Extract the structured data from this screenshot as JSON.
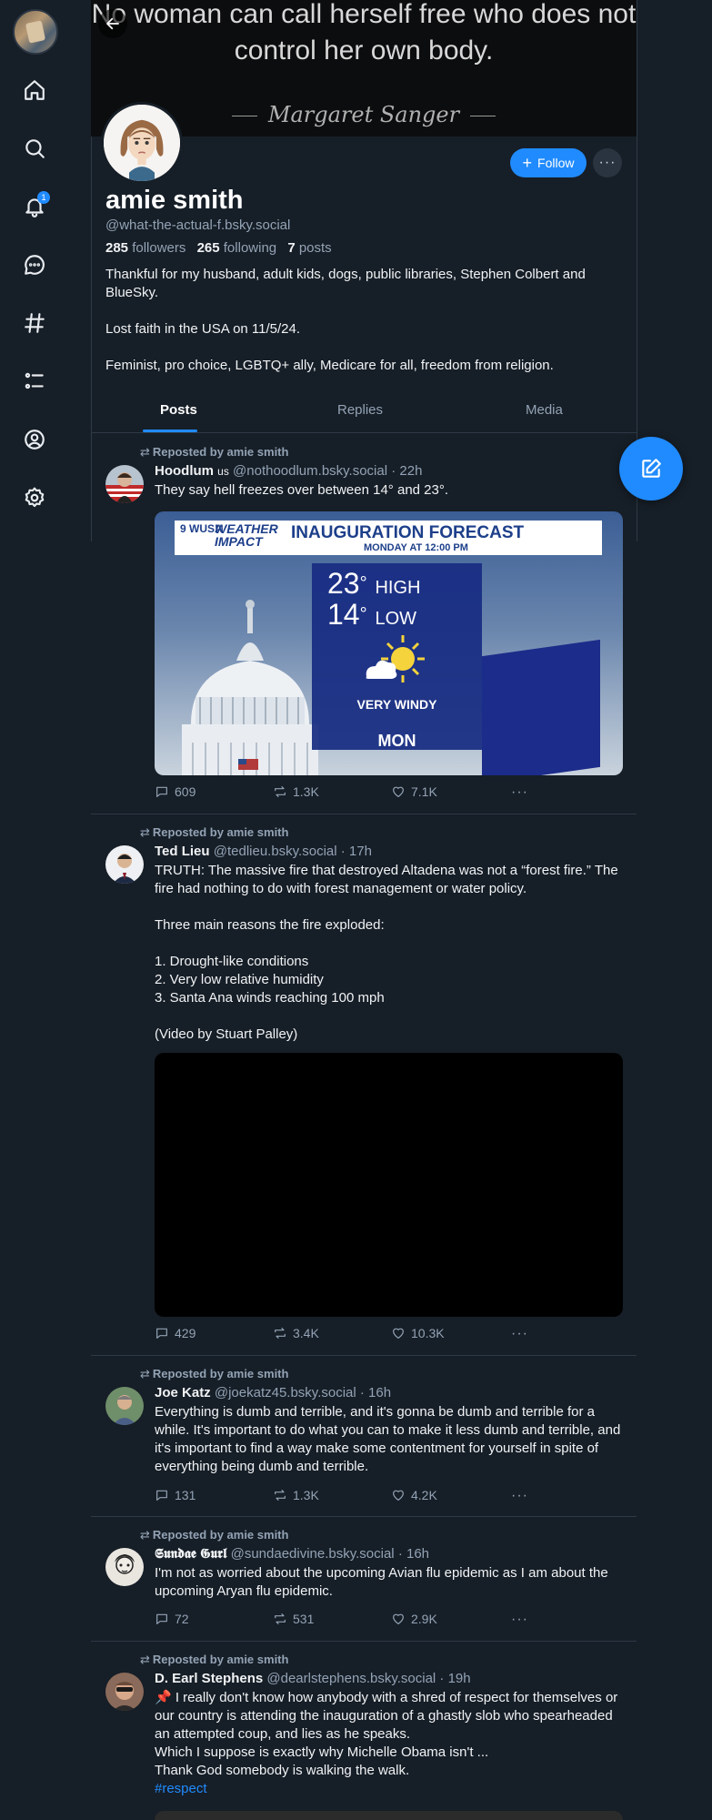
{
  "nav": {
    "notification_count": "1"
  },
  "banner": {
    "quote": "No woman can call herself free who does not control her own body.",
    "author": "Margaret Sanger"
  },
  "profile": {
    "display_name": "amie smith",
    "handle": "@what-the-actual-f.bsky.social",
    "followers_count": "285",
    "followers_label": "followers",
    "following_count": "265",
    "following_label": "following",
    "posts_count": "7",
    "posts_label": "posts",
    "bio": [
      "Thankful for my husband, adult kids, dogs, public libraries, Stephen Colbert and BlueSky.",
      "Lost faith in the USA on 11/5/24.",
      "Feminist, pro choice, LGBTQ+ ally, Medicare for all, freedom from religion."
    ],
    "follow_label": "Follow",
    "more_label": "···"
  },
  "tabs": [
    "Posts",
    "Replies",
    "Media"
  ],
  "posts": [
    {
      "repost_label": "Reposted by amie smith",
      "author": "Hoodlum",
      "author_flag": "us",
      "handle": "@nothoodlum.bsky.social",
      "time": "· 22h",
      "text": "They say hell freezes over between 14° and 23°.",
      "media": {
        "station": "9 WUSA",
        "brand_line1": "WEATHER",
        "brand_line2": "IMPACT",
        "title": "INAUGURATION FORECAST",
        "subtitle": "MONDAY AT 12:00 PM",
        "high_temp": "23",
        "high_label": "HIGH",
        "low_temp": "14",
        "low_label": "LOW",
        "condition": "VERY WINDY",
        "day": "MON"
      },
      "replies": "609",
      "reposts": "1.3K",
      "likes": "7.1K"
    },
    {
      "repost_label": "Reposted by amie smith",
      "author": "Ted Lieu",
      "handle": "@tedlieu.bsky.social",
      "time": "· 17h",
      "text": "TRUTH: The massive fire that destroyed Altadena was not a “forest fire.” The fire had nothing to do with forest management or water policy.\n\nThree main reasons the fire exploded:\n\n1. Drought-like conditions\n2. Very low relative humidity\n3. Santa Ana winds reaching 100 mph\n\n(Video by Stuart Palley)",
      "replies": "429",
      "reposts": "3.4K",
      "likes": "10.3K"
    },
    {
      "repost_label": "Reposted by amie smith",
      "author": "Joe Katz",
      "handle": "@joekatz45.bsky.social",
      "time": "· 16h",
      "text": "Everything is dumb and terrible, and it's gonna be dumb and terrible for a while. It's important to do what you can to make it less dumb and terrible, and it's important to find a way make some contentment for yourself in spite of everything being dumb and terrible.",
      "replies": "131",
      "reposts": "1.3K",
      "likes": "4.2K"
    },
    {
      "repost_label": "Reposted by amie smith",
      "author": "𝕾𝖚𝖓𝖉𝖆𝖊 𝕲𝖚𝖗𝖑",
      "handle": "@sundaedivine.bsky.social",
      "time": "· 16h",
      "text": "I'm not as worried about the upcoming Avian flu epidemic as I am about the upcoming Aryan flu epidemic.",
      "replies": "72",
      "reposts": "531",
      "likes": "2.9K"
    },
    {
      "repost_label": "Reposted by amie smith",
      "author": "D. Earl Stephens",
      "handle": "@dearlstephens.bsky.social",
      "time": "· 19h",
      "text": "📌 I really don't know how anybody with a shred of respect for themselves or our country is attending the inauguration of a ghastly slob who spearheaded an attempted coup, and lies as he speaks.\nWhich I suppose is exactly why Michelle Obama isn't ...\nThank God somebody is walking the walk.",
      "hashtag": "#respect"
    }
  ]
}
